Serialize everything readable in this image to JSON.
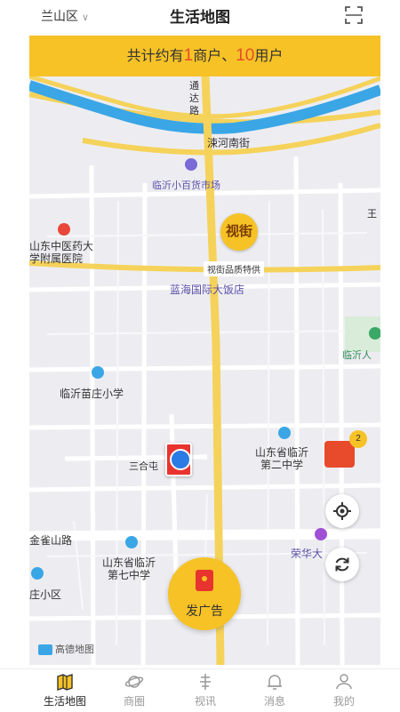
{
  "header": {
    "district": "兰山区",
    "title": "生活地图"
  },
  "banner": {
    "prefix": "共计约有",
    "merchant_count": "1",
    "middle": "商户、",
    "user_count": "10",
    "suffix": "用户"
  },
  "map": {
    "labels": {
      "tongda_road": "通达路",
      "sushe_south_street": "涑河南街",
      "linyi_grocery": "临沂小百货市场",
      "wang": "王",
      "hospital": "山东中医药大学附属医院",
      "hospital_line1": "山东中医药大",
      "hospital_line2": "学附属医院",
      "shijie_badge": "视街",
      "shijie_tag": "视街品质特供",
      "lanhai_hotel": "蓝海国际大饭店",
      "linyi_ren": "临沂人",
      "miaozhuang_school": "临沂苗庄小学",
      "sanhe": "三合屯",
      "no2_school_line1": "山东省临沂",
      "no2_school_line2": "第二中学",
      "jinque_road": "金雀山路",
      "no7_school_line1": "山东省临沂",
      "no7_school_line2": "第七中学",
      "ronghua": "荣华大",
      "community": "庄小区",
      "amap": "高德地图"
    },
    "red_packet_count": "2"
  },
  "fab": {
    "label": "发广告"
  },
  "tabs": [
    {
      "label": "生活地图",
      "icon": "map-icon",
      "active": true
    },
    {
      "label": "商圈",
      "icon": "planet-icon",
      "active": false
    },
    {
      "label": "视讯",
      "icon": "antenna-icon",
      "active": false
    },
    {
      "label": "消息",
      "icon": "bell-icon",
      "active": false
    },
    {
      "label": "我的",
      "icon": "user-icon",
      "active": false
    }
  ],
  "colors": {
    "accent": "#f6c226",
    "highlight_number": "#e94b2b",
    "river": "#3aa6e6",
    "main_road": "#f5d25a"
  }
}
